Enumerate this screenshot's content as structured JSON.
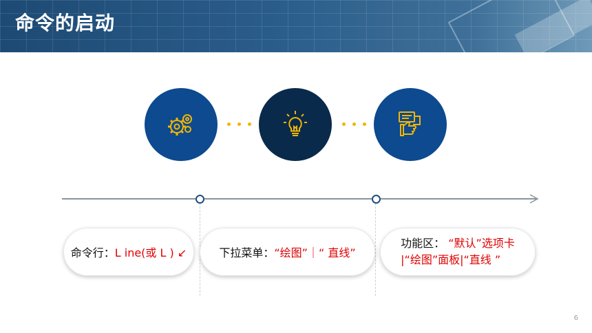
{
  "header": {
    "title": "命令的启动"
  },
  "icons": [
    "gears-icon",
    "lightbulb-icon",
    "hand-chat-icon"
  ],
  "colors": {
    "accent": "#f2b500",
    "dark_blue": "#0a2a4c",
    "blue": "#0d4a8f",
    "red": "#e00000"
  },
  "methods": [
    {
      "label": "命令行：",
      "value": "L ine(或 L ) ↙"
    },
    {
      "label": "下拉菜单：",
      "value": "“绘图”｜“ 直线”"
    },
    {
      "label": "功能区：",
      "value": "“默认”选项卡",
      "value_line2": "|“绘图”面板|“直线 ”"
    }
  ],
  "page_number": "6"
}
